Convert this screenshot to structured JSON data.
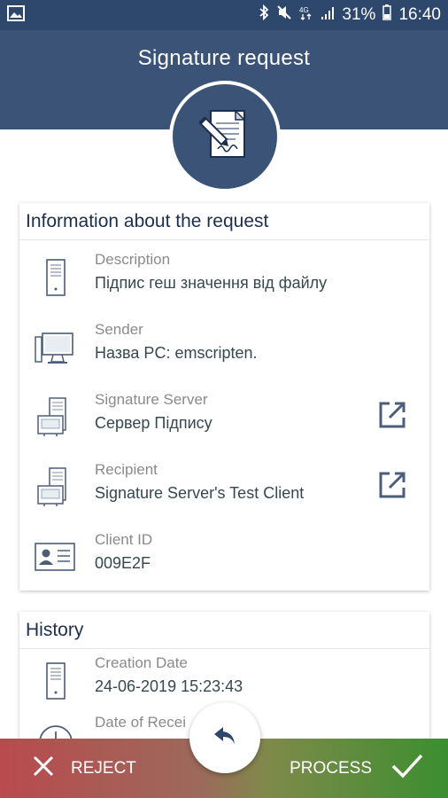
{
  "status_bar": {
    "battery": "31%",
    "time": "16:40",
    "icons": [
      "image-icon",
      "bluetooth-icon",
      "mute-icon",
      "network-4g-icon",
      "signal-icon",
      "battery-icon"
    ]
  },
  "header": {
    "title": "Signature request"
  },
  "info_card": {
    "title": "Information about the request",
    "rows": [
      {
        "label": "Description",
        "value": "Підпис геш значення від файлу",
        "icon": "server-tower-icon"
      },
      {
        "label": "Sender",
        "value": "Назва PC: emscripten.",
        "icon": "desktop-computer-icon"
      },
      {
        "label": "Signature Server",
        "value": "Сервер Підпису",
        "icon": "server-rack-icon",
        "link": "open-external-icon"
      },
      {
        "label": "Recipient",
        "value": "Signature Server's Test Client",
        "icon": "server-rack-icon",
        "link": "open-external-icon"
      },
      {
        "label": "Client ID",
        "value": "009E2F",
        "icon": "id-card-icon"
      }
    ]
  },
  "history_card": {
    "title": "History",
    "rows": [
      {
        "label": "Creation Date",
        "value": "24-06-2019 15:23:43",
        "icon": "server-tower-icon"
      },
      {
        "label": "Date of Recei",
        "value": "",
        "icon": "clock-icon"
      }
    ]
  },
  "actions": {
    "reject_label": "REJECT",
    "process_label": "PROCESS",
    "back_icon": "reply-arrow-icon"
  },
  "colors": {
    "header": "#3a5377",
    "status_bar": "#2e476d",
    "reject": "#b94a4d",
    "process": "#3b8e2f"
  }
}
